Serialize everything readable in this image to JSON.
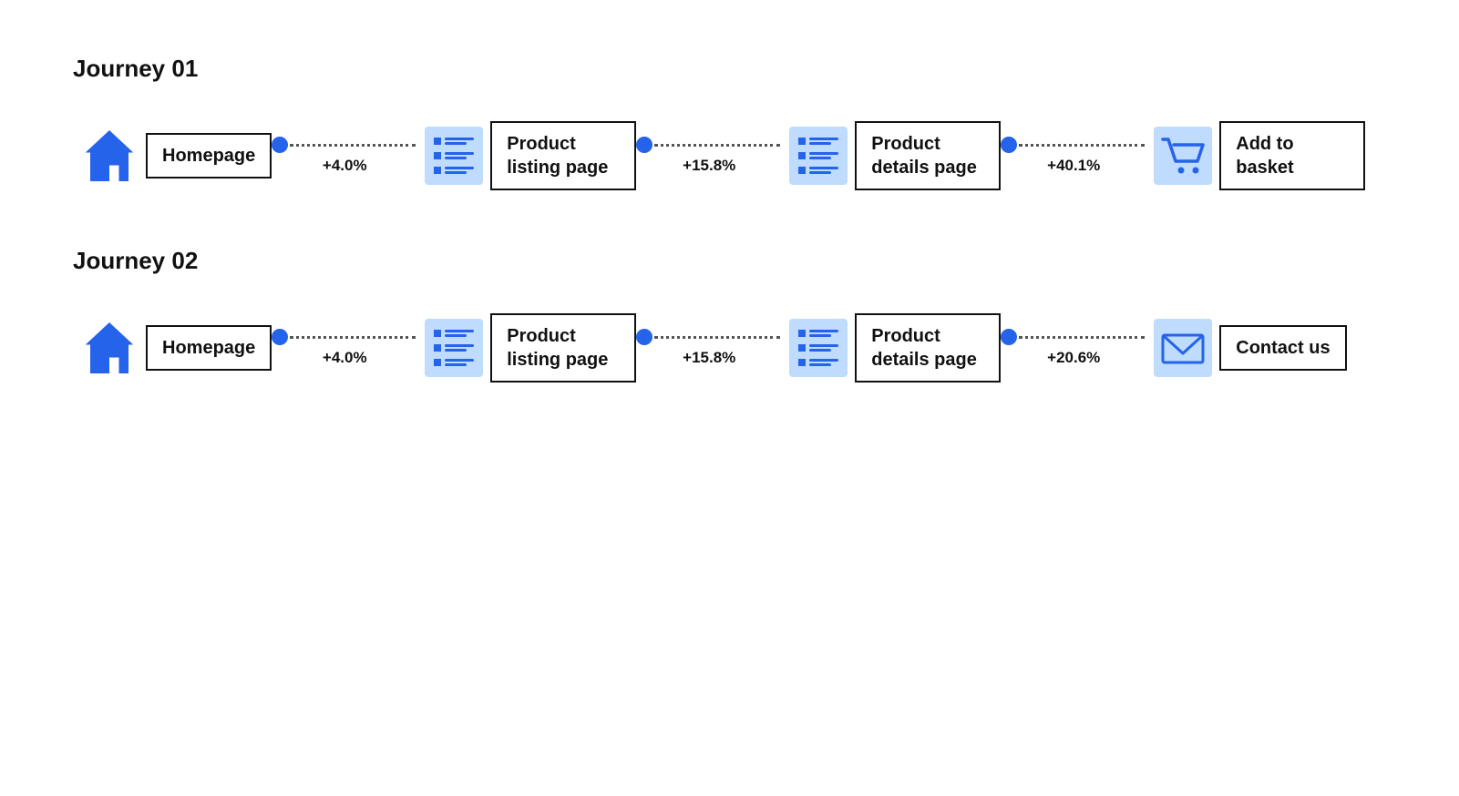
{
  "journeys": [
    {
      "id": "journey-01",
      "title": "Journey 01",
      "nodes": [
        {
          "id": "home1",
          "type": "home",
          "label": "Homepage"
        },
        {
          "id": "listing1",
          "type": "listing",
          "label": "Product listing page"
        },
        {
          "id": "details1",
          "type": "listing",
          "label": "Product details page"
        },
        {
          "id": "basket1",
          "type": "cart",
          "label": "Add to basket"
        }
      ],
      "connectors": [
        {
          "percent": "+4.0%"
        },
        {
          "percent": "+15.8%"
        },
        {
          "percent": "+40.1%"
        }
      ]
    },
    {
      "id": "journey-02",
      "title": "Journey 02",
      "nodes": [
        {
          "id": "home2",
          "type": "home",
          "label": "Homepage"
        },
        {
          "id": "listing2",
          "type": "listing",
          "label": "Product listing page"
        },
        {
          "id": "details2",
          "type": "listing",
          "label": "Product details page"
        },
        {
          "id": "contact2",
          "type": "mail",
          "label": "Contact us"
        }
      ],
      "connectors": [
        {
          "percent": "+4.0%"
        },
        {
          "percent": "+15.8%"
        },
        {
          "percent": "+20.6%"
        }
      ]
    }
  ]
}
